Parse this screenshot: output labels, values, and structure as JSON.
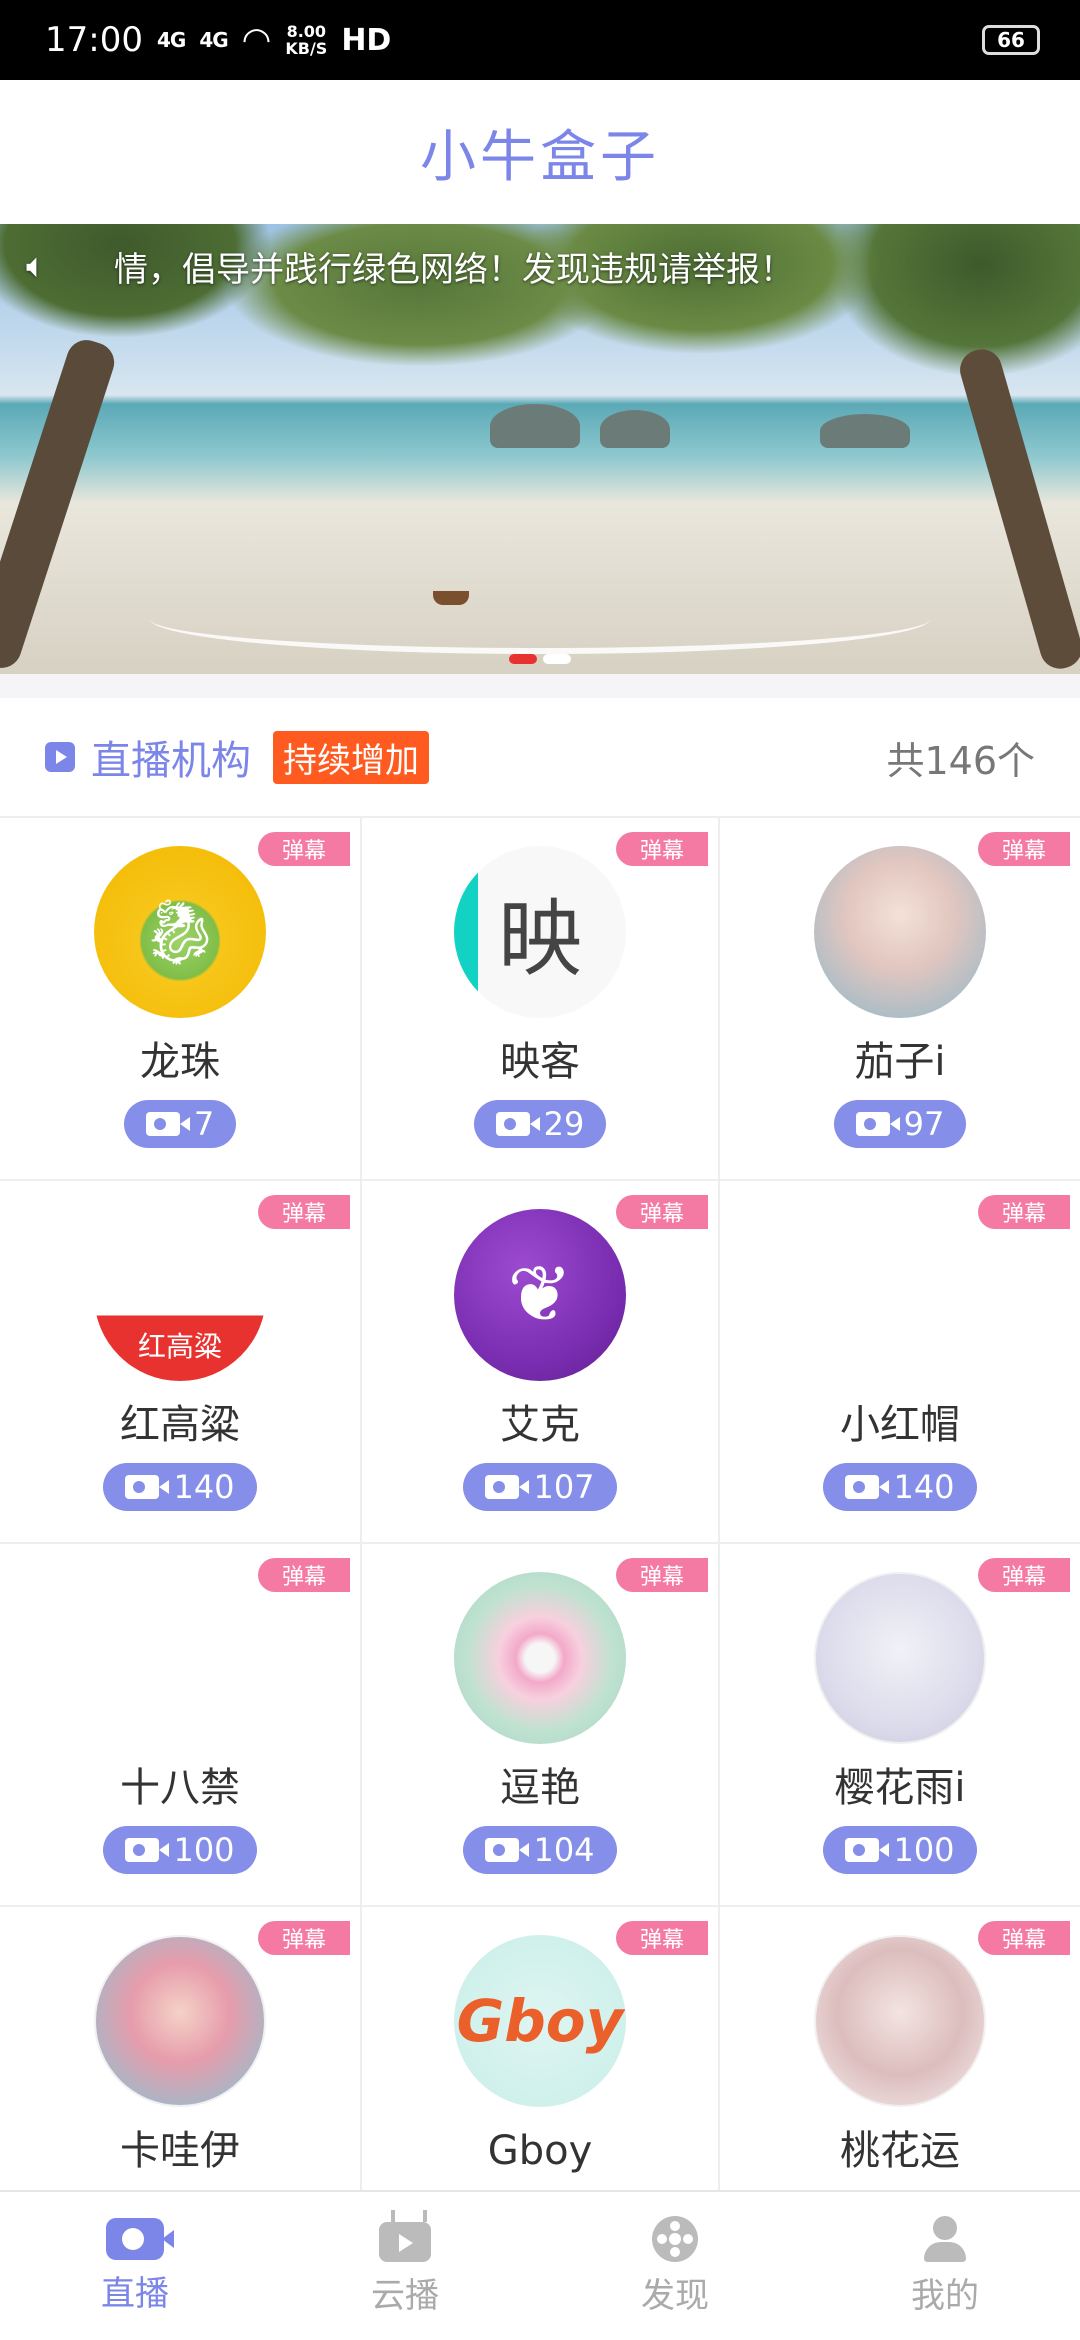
{
  "status_bar": {
    "time": "17:00",
    "signal_1": "4G",
    "signal_2": "4G",
    "speed": "8.00\nKB/S",
    "hd": "HD",
    "battery": "66"
  },
  "header": {
    "title": "小牛盒子"
  },
  "banner": {
    "notice": "情，倡导并践行绿色网络！发现违规请举报！",
    "dots": 2,
    "active_dot": 0
  },
  "section": {
    "title": "直播机构",
    "badge": "持续增加",
    "count": "共146个"
  },
  "platforms": [
    {
      "name": "龙珠",
      "count": "7",
      "tag": "弹幕",
      "avatar": "dragon-avatar"
    },
    {
      "name": "映客",
      "count": "29",
      "tag": "弹幕",
      "avatar": "yingke-logo",
      "logo_text": "映"
    },
    {
      "name": "茄子i",
      "count": "97",
      "tag": "弹幕",
      "avatar": "girl-avatar"
    },
    {
      "name": "红高粱",
      "count": "140",
      "tag": "弹幕",
      "avatar": "red-camera-logo",
      "logo_text": "红高粱"
    },
    {
      "name": "艾克",
      "count": "107",
      "tag": "弹幕",
      "avatar": "aike-logo"
    },
    {
      "name": "小红帽",
      "count": "140",
      "tag": "弹幕",
      "avatar": "empty-avatar"
    },
    {
      "name": "十八禁",
      "count": "100",
      "tag": "弹幕",
      "avatar": "empty-avatar"
    },
    {
      "name": "逗艳",
      "count": "104",
      "tag": "弹幕",
      "avatar": "lotus-avatar"
    },
    {
      "name": "樱花雨i",
      "count": "100",
      "tag": "弹幕",
      "avatar": "white-haired-girl-avatar"
    },
    {
      "name": "卡哇伊",
      "count": "",
      "tag": "弹幕",
      "avatar": "anime-girl-avatar"
    },
    {
      "name": "Gboy",
      "count": "",
      "tag": "弹幕",
      "avatar": "gboy-logo",
      "logo_text": "Gboy"
    },
    {
      "name": "桃花运",
      "count": "",
      "tag": "弹幕",
      "avatar": "beauty-avatar"
    }
  ],
  "bottom_nav": [
    {
      "label": "直播",
      "icon": "video-camera-icon",
      "active": true
    },
    {
      "label": "云播",
      "icon": "tv-icon",
      "active": false
    },
    {
      "label": "发现",
      "icon": "film-reel-icon",
      "active": false
    },
    {
      "label": "我的",
      "icon": "user-icon",
      "active": false
    }
  ],
  "colors": {
    "accent": "#7b86e8",
    "badge_orange": "#ff5a1f",
    "danmu_pink": "#f47aa3",
    "pill": "#858ee8"
  }
}
